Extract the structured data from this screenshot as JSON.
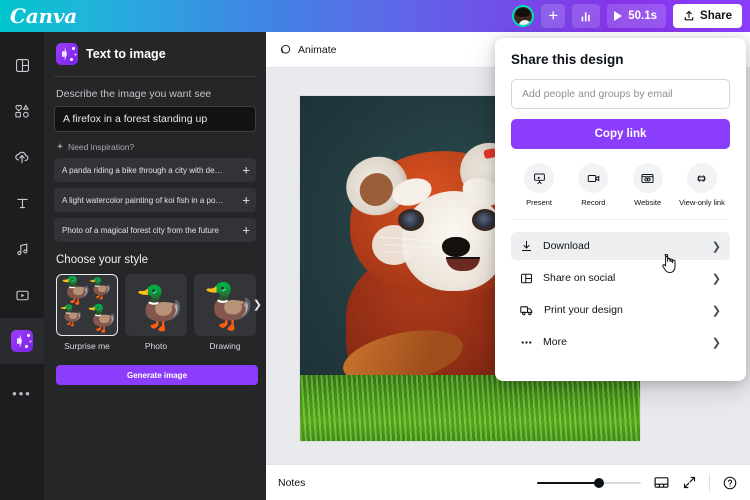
{
  "header": {
    "logo": "Canva",
    "add_label": "+",
    "chart_icon": "bar-chart-icon",
    "timer": "50.1s",
    "share_label": "Share"
  },
  "rail": {
    "items": [
      {
        "icon": "design-layout-icon",
        "name": "design"
      },
      {
        "icon": "elements-shapes-icon",
        "name": "elements"
      },
      {
        "icon": "upload-cloud-icon",
        "name": "uploads"
      },
      {
        "icon": "text-t-icon",
        "name": "text"
      },
      {
        "icon": "music-note-icon",
        "name": "audio"
      },
      {
        "icon": "video-play-icon",
        "name": "videos"
      },
      {
        "icon": "apps-magic-icon",
        "name": "apps",
        "active": true
      },
      {
        "icon": "more-dots-icon",
        "name": "more"
      }
    ]
  },
  "panel": {
    "title": "Text to image",
    "title_icon": "magic-sparkle-icon",
    "prompt_label": "Describe the image you want see",
    "prompt_value": "A firefox in a forest standing up",
    "prompt_placeholder": "Describe the image you want see",
    "inspiration_label": "Need inspiration?",
    "inspiration_icon": "sparkle-icon",
    "inspirations": [
      "A panda riding a bike through a city with depth of field",
      "A light watercolor painting of koi fish in a pond",
      "Photo of a magical forest city from the future"
    ],
    "add_icon": "plus-icon",
    "style_label": "Choose your style",
    "styles": [
      {
        "label": "Surprise me",
        "thumb": "four-ducks",
        "selected": true
      },
      {
        "label": "Photo",
        "thumb": "photo-duck",
        "selected": false
      },
      {
        "label": "Drawing",
        "thumb": "drawing-duck",
        "selected": false
      }
    ],
    "carousel_next_icon": "chevron-right-icon",
    "generate_label": "Generate image"
  },
  "editor": {
    "toolbar": {
      "animate_label": "Animate",
      "animate_icon": "animate-circles-icon"
    },
    "canvas": {
      "artwork_alt": "red panda standing in grass"
    },
    "bottom": {
      "notes_label": "Notes",
      "zoom_value": 60,
      "grid_icon": "page-grid-icon",
      "expand_icon": "fullscreen-expand-icon",
      "help_icon": "help-question-icon"
    }
  },
  "share": {
    "title": "Share this design",
    "email_placeholder": "Add people and groups by email",
    "email_value": "",
    "copy_link_label": "Copy link",
    "quick_actions": [
      {
        "label": "Present",
        "icon": "present-projector-icon"
      },
      {
        "label": "Record",
        "icon": "record-video-icon"
      },
      {
        "label": "Website",
        "icon": "website-browser-icon"
      },
      {
        "label": "View-only link",
        "icon": "link-chain-icon"
      }
    ],
    "menu": [
      {
        "label": "Download",
        "icon": "download-arrow-icon",
        "hovered": true
      },
      {
        "label": "Share on social",
        "icon": "share-social-icon",
        "hovered": false
      },
      {
        "label": "Print your design",
        "icon": "print-truck-icon",
        "hovered": false
      },
      {
        "label": "More",
        "icon": "more-dots-icon",
        "hovered": false
      }
    ],
    "chevron_icon": "chevron-right-icon"
  },
  "colors": {
    "accent_purple": "#8b3dfc",
    "brand_teal": "#00c4cc",
    "panel_bg": "#252628",
    "rail_bg": "#1c1d1f"
  }
}
